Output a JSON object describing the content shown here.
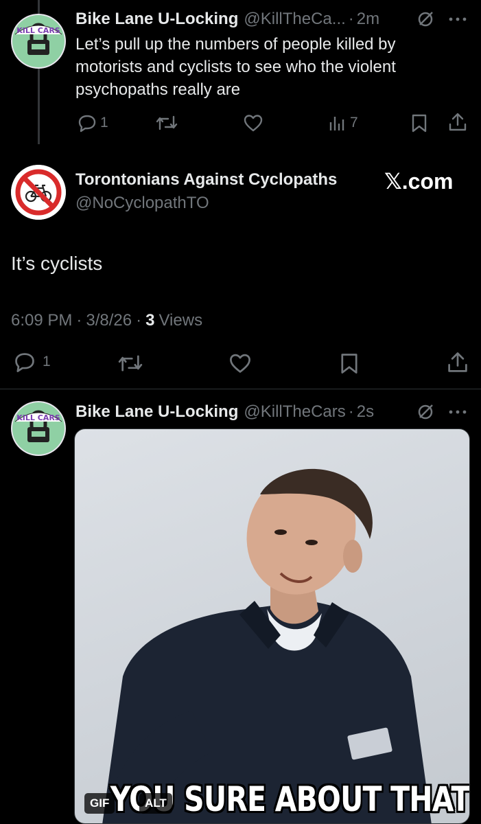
{
  "tweet1": {
    "display_name": "Bike Lane U-Locking",
    "handle": "@KillTheCa...",
    "time": "2m",
    "text_line1": "Let’s pull up the numbers of people killed by",
    "text_line2": "motorists and cyclists to see who the violent",
    "text_line3": "psychopaths really are",
    "reply_count": "1",
    "views_count": "7",
    "avatar_text": "KILL CARS"
  },
  "tweet2": {
    "display_name": "Torontonians Against Cyclopaths",
    "handle": "@NoCyclopathTO",
    "text": "It’s cyclists",
    "time": "6:09 PM",
    "date": "3/8/26",
    "views_num": "3",
    "views_label": "Views",
    "reply_count": "1"
  },
  "watermark": {
    "text": "𝕏.com"
  },
  "tweet3": {
    "display_name": "Bike Lane U-Locking",
    "handle": "@KillTheCars",
    "time": "2s",
    "avatar_text": "KILL CARS",
    "media": {
      "caption": "YOU SURE ABOUT THAT?",
      "gif_badge": "GIF",
      "alt_badge": "ALT"
    }
  },
  "separator": "·",
  "colors": {
    "background": "#000000",
    "text": "#e7e9ea",
    "muted": "#71767b",
    "avatar_green": "#8fd0a4",
    "no_sign_red": "#d92b2b"
  }
}
